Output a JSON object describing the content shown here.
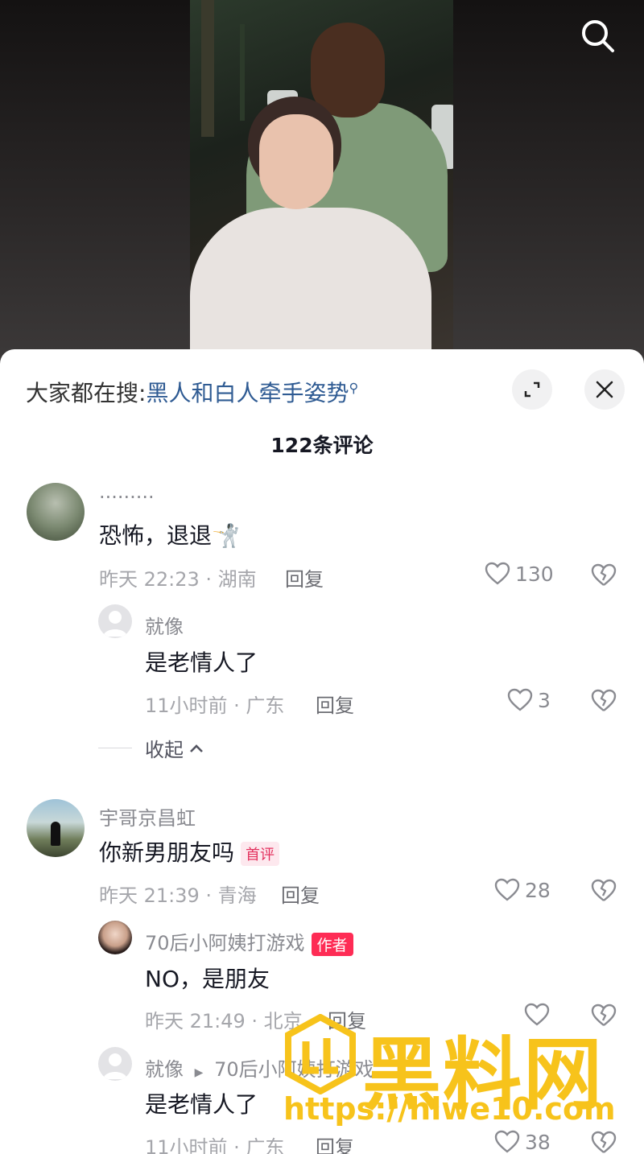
{
  "video": {
    "search_icon": "search-icon"
  },
  "sheet": {
    "hot_search_prefix": "大家都在搜:",
    "hot_search_link": "黑人和白人牵手姿势",
    "comment_count": "122条评论",
    "expand_icon": "expand-icon",
    "close_icon": "close-icon",
    "collapse_label": "收起"
  },
  "comments": [
    {
      "user": "·········",
      "text": "恐怖，退退🤺",
      "meta": "昨天 22:23 · 湖南",
      "reply": "回复",
      "likes": "130"
    },
    {
      "user": "就像",
      "text": "是老情人了",
      "meta": "11小时前 · 广东",
      "reply": "回复",
      "likes": "3"
    },
    {
      "user": "宇哥京昌虹",
      "text": "你新男朋友吗",
      "badge": "首评",
      "meta": "昨天 21:39 · 青海",
      "reply": "回复",
      "likes": "28"
    },
    {
      "user": "70后小阿姨打游戏",
      "badge": "作者",
      "text": "NO，是朋友",
      "meta": "昨天 21:49 · 北京",
      "reply": "回复",
      "likes": ""
    },
    {
      "user": "就像",
      "reply_to": "70后小阿姨打游戏",
      "text": "是老情人了",
      "meta": "11小时前 · 广东",
      "reply": "回复",
      "likes": "38"
    }
  ],
  "watermark": {
    "title": "黑料网",
    "url": "https://hlwe10.com"
  },
  "colors": {
    "link": "#2f5b93",
    "author_badge": "#fe2c55",
    "watermark": "#f7c31b"
  }
}
